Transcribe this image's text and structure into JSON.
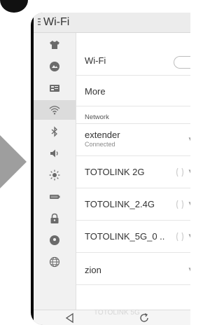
{
  "titlebar": {
    "title": "Wi-Fi"
  },
  "sidebar": {
    "items": [
      {
        "icon": "tshirt-icon"
      },
      {
        "icon": "theme-icon"
      },
      {
        "icon": "display-icon"
      },
      {
        "icon": "wifi-icon",
        "active": true
      },
      {
        "icon": "bluetooth-icon"
      },
      {
        "icon": "volume-icon"
      },
      {
        "icon": "brightness-icon"
      },
      {
        "icon": "battery-icon"
      },
      {
        "icon": "lock-icon"
      },
      {
        "icon": "location-icon"
      },
      {
        "icon": "globe-icon"
      }
    ]
  },
  "main": {
    "wifi_label": "Wi-Fi",
    "more_label": "More",
    "section_network": "Network",
    "networks": [
      {
        "name": "extender",
        "status": "Connected"
      },
      {
        "name": "TOTOLINK 2G"
      },
      {
        "name": "TOTOLINK_2.4G"
      },
      {
        "name": "TOTOLINK_5G_0 .."
      },
      {
        "name": "zion"
      }
    ],
    "faded_network": "TOTOLINK 5G"
  },
  "navbar": {
    "icons": [
      "back-icon",
      "home-icon"
    ]
  },
  "colors": {
    "title_bg": "#ececec",
    "sidebar_bg": "#f1f1f1",
    "active_bg": "#dcdcdc",
    "arrow": "#9e9e9e"
  }
}
